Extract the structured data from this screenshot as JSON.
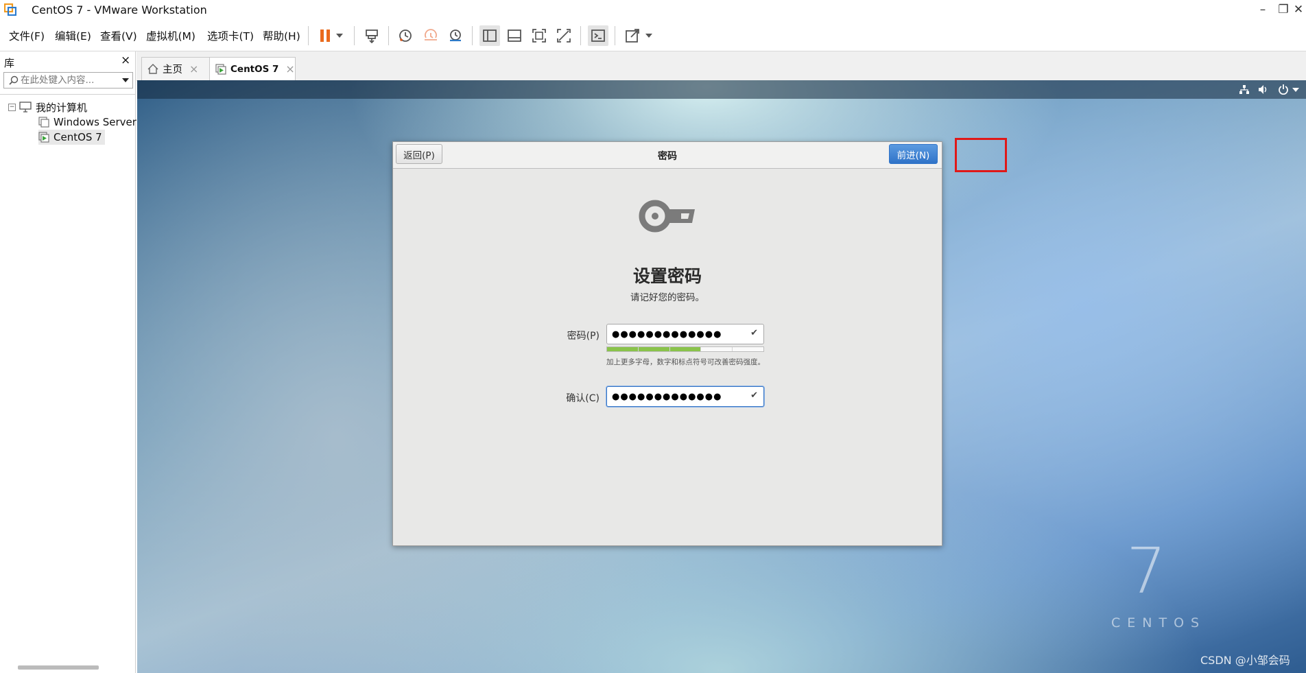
{
  "window": {
    "title": "CentOS 7  - VMware Workstation",
    "minimize_icon": "minimize-icon",
    "restore_icon": "restore-icon",
    "close_icon": "close-icon"
  },
  "menu": [
    "文件(F)",
    "编辑(E)",
    "查看(V)",
    "虚拟机(M)",
    "选项卡(T)",
    "帮助(H)"
  ],
  "toolbar": {
    "icons": [
      "pause-icon",
      "dropdown-icon",
      "send-ctrl-alt-del-icon",
      "snapshot-icon",
      "revert-snapshot-icon",
      "snapshot-manager-icon",
      "show-library-icon",
      "thumbnail-bar-icon",
      "full-screen-icon",
      "unity-icon",
      "console-view-icon",
      "stretch-guest-icon",
      "dropdown-icon"
    ],
    "colors": {
      "pause": "#ea6a1c"
    }
  },
  "library": {
    "title": "库",
    "close": "×",
    "search_placeholder": "在此处键入内容...",
    "tree": {
      "root": "我的计算机",
      "items": [
        "Windows Server",
        "CentOS 7"
      ],
      "selected": "CentOS 7"
    }
  },
  "tabs": [
    {
      "label": "主页",
      "icon": "home-icon",
      "close": "×"
    },
    {
      "label": "CentOS 7",
      "icon": "vm-running-icon",
      "close": "×"
    }
  ],
  "vm_status_icons": [
    "network-icon",
    "volume-icon",
    "power-icon",
    "menu-down-icon"
  ],
  "dialog": {
    "back_label": "返回(P)",
    "title": "密码",
    "next_label": "前进(N)",
    "heading": "设置密码",
    "subtitle": "请记好您的密码。",
    "password_label": "密码(P)",
    "password_value": "●●●●●●●●●●●●●",
    "confirm_label": "确认(C)",
    "confirm_value": "●●●●●●●●●●●●●",
    "strength_hint": "加上更多字母，数字和标点符号可改善密码强度。",
    "strength_level": 0.6,
    "strength_color": "#8ac34b",
    "accent": "#2f73c8"
  },
  "watermark": {
    "seven": "7",
    "centos": "CENTOS"
  },
  "csdn_mark": "CSDN @小邹会码",
  "highlight_color": "#e01818"
}
